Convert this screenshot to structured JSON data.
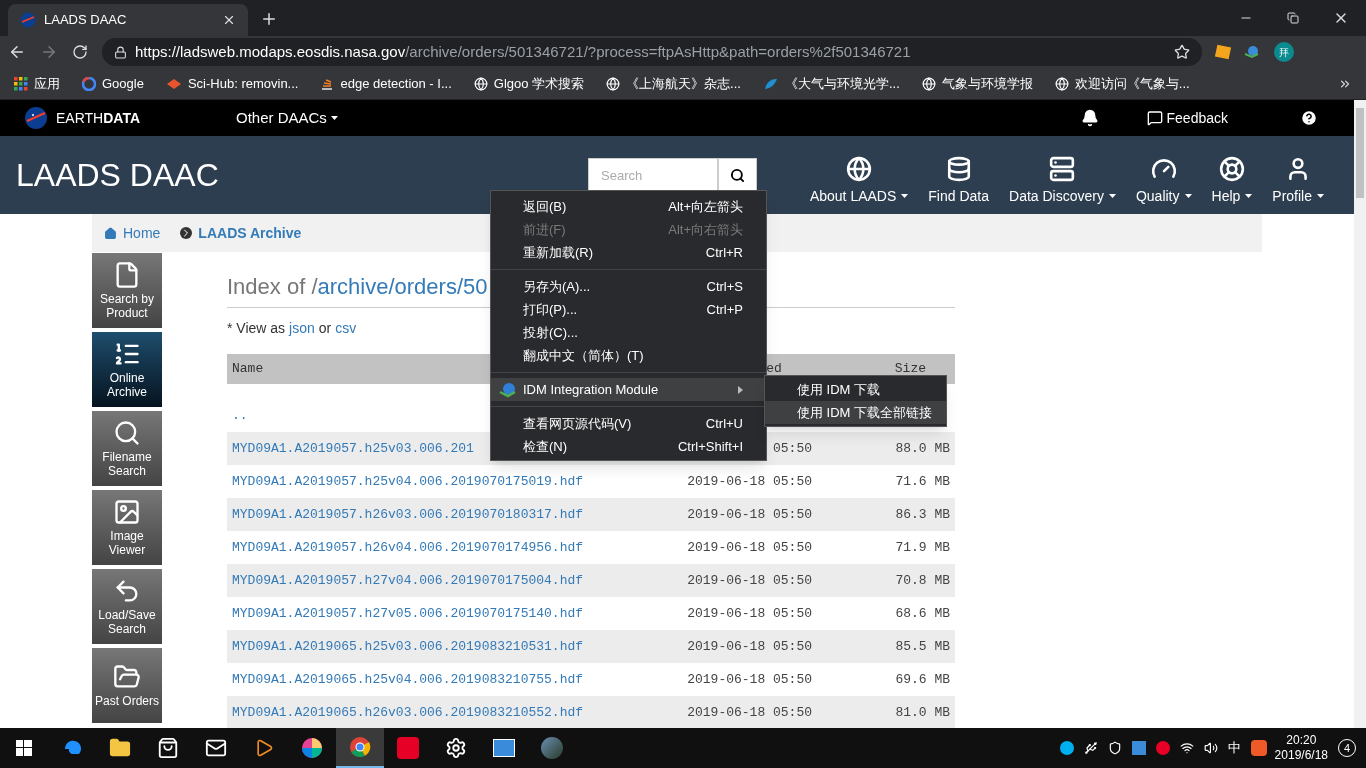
{
  "browser": {
    "tab_title": "LAADS DAAC",
    "url": {
      "host": "https://ladsweb.modaps.eosdis.nasa.gov",
      "path": "/archive/orders/501346721/?process=ftpAsHttp&path=orders%2f501346721"
    },
    "profile_initial": "拜",
    "bookmarks": [
      {
        "label": "应用",
        "kind": "apps"
      },
      {
        "label": "Google",
        "kind": "google"
      },
      {
        "label": "Sci-Hub: removin...",
        "kind": "scihub"
      },
      {
        "label": "edge detection - I...",
        "kind": "stack"
      },
      {
        "label": "Glgoo 学术搜索",
        "kind": "globe"
      },
      {
        "label": "《上海航天》杂志...",
        "kind": "globe"
      },
      {
        "label": "《大气与环境光学...",
        "kind": "fa"
      },
      {
        "label": "气象与环境学报",
        "kind": "globe"
      },
      {
        "label": "欢迎访问《气象与...",
        "kind": "globe"
      }
    ]
  },
  "site": {
    "brand": "EARTH",
    "brand_bold": "DATA",
    "other_daacs": "Other DAACs",
    "feedback": "Feedback",
    "title": "LAADS DAAC",
    "search": {
      "placeholder": "Search"
    },
    "nav": [
      {
        "label": "About LAADS",
        "dropdown": true
      },
      {
        "label": "Find Data",
        "dropdown": false
      },
      {
        "label": "Data Discovery",
        "dropdown": true
      },
      {
        "label": "Quality",
        "dropdown": true
      },
      {
        "label": "Help",
        "dropdown": true
      },
      {
        "label": "Profile",
        "dropdown": true
      }
    ]
  },
  "breadcrumb": [
    {
      "label": "Home"
    },
    {
      "label": "LAADS Archive"
    }
  ],
  "sidebar": [
    {
      "label": "Search by Product",
      "selected": false
    },
    {
      "label": "Online Archive",
      "selected": true
    },
    {
      "label": "Filename Search",
      "selected": false
    },
    {
      "label": "Image Viewer",
      "selected": false
    },
    {
      "label": "Load/Save Search",
      "selected": false
    },
    {
      "label": "Past Orders",
      "selected": false
    }
  ],
  "index": {
    "title_prefix": "Index of /",
    "title_link": "archive/orders/50",
    "view_as": "* View as",
    "links": [
      "json",
      "csv"
    ],
    "or": "or"
  },
  "table": {
    "columns": [
      "Name",
      "ed",
      "Size"
    ],
    "rows": [
      {
        "name": "..",
        "modified": "",
        "size": ""
      },
      {
        "name": "MYD09A1.A2019057.h25v03.006.201",
        "modified": "05:50",
        "size": "88.0 MB"
      },
      {
        "name": "MYD09A1.A2019057.h25v04.006.2019070175019.hdf",
        "modified": "2019-06-18 05:50",
        "size": "71.6 MB"
      },
      {
        "name": "MYD09A1.A2019057.h26v03.006.2019070180317.hdf",
        "modified": "2019-06-18 05:50",
        "size": "86.3 MB"
      },
      {
        "name": "MYD09A1.A2019057.h26v04.006.2019070174956.hdf",
        "modified": "2019-06-18 05:50",
        "size": "71.9 MB"
      },
      {
        "name": "MYD09A1.A2019057.h27v04.006.2019070175004.hdf",
        "modified": "2019-06-18 05:50",
        "size": "70.8 MB"
      },
      {
        "name": "MYD09A1.A2019057.h27v05.006.2019070175140.hdf",
        "modified": "2019-06-18 05:50",
        "size": "68.6 MB"
      },
      {
        "name": "MYD09A1.A2019065.h25v03.006.2019083210531.hdf",
        "modified": "2019-06-18 05:50",
        "size": "85.5 MB"
      },
      {
        "name": "MYD09A1.A2019065.h25v04.006.2019083210755.hdf",
        "modified": "2019-06-18 05:50",
        "size": "69.6 MB"
      },
      {
        "name": "MYD09A1.A2019065.h26v03.006.2019083210552.hdf",
        "modified": "2019-06-18 05:50",
        "size": "81.0 MB"
      }
    ]
  },
  "context_menu": {
    "items": [
      {
        "kind": "item",
        "label": "返回(B)",
        "shortcut": "Alt+向左箭头",
        "disabled": false,
        "selected": false
      },
      {
        "kind": "item",
        "label": "前进(F)",
        "shortcut": "Alt+向右箭头",
        "disabled": true,
        "selected": false
      },
      {
        "kind": "item",
        "label": "重新加载(R)",
        "shortcut": "Ctrl+R",
        "disabled": false,
        "selected": false
      },
      {
        "kind": "separator"
      },
      {
        "kind": "item",
        "label": "另存为(A)...",
        "shortcut": "Ctrl+S",
        "disabled": false,
        "selected": false
      },
      {
        "kind": "item",
        "label": "打印(P)...",
        "shortcut": "Ctrl+P",
        "disabled": false,
        "selected": false
      },
      {
        "kind": "item",
        "label": "投射(C)...",
        "disabled": false,
        "selected": false
      },
      {
        "kind": "item",
        "label": "翻成中文（简体）(T)",
        "disabled": false,
        "selected": false
      },
      {
        "kind": "separator"
      },
      {
        "kind": "submenu",
        "label": "IDM Integration Module",
        "disabled": false,
        "selected": true
      },
      {
        "kind": "separator"
      },
      {
        "kind": "item",
        "label": "查看网页源代码(V)",
        "shortcut": "Ctrl+U",
        "disabled": false,
        "selected": false
      },
      {
        "kind": "item",
        "label": "检查(N)",
        "shortcut": "Ctrl+Shift+I",
        "disabled": false,
        "selected": false
      }
    ],
    "submenu": [
      {
        "label": "使用 IDM 下载",
        "selected": false
      },
      {
        "label": "使用 IDM 下载全部链接",
        "selected": true
      }
    ]
  },
  "taskbar": {
    "time": "20:20",
    "date": "2019/6/18",
    "ime": "中",
    "notifications": "4"
  }
}
